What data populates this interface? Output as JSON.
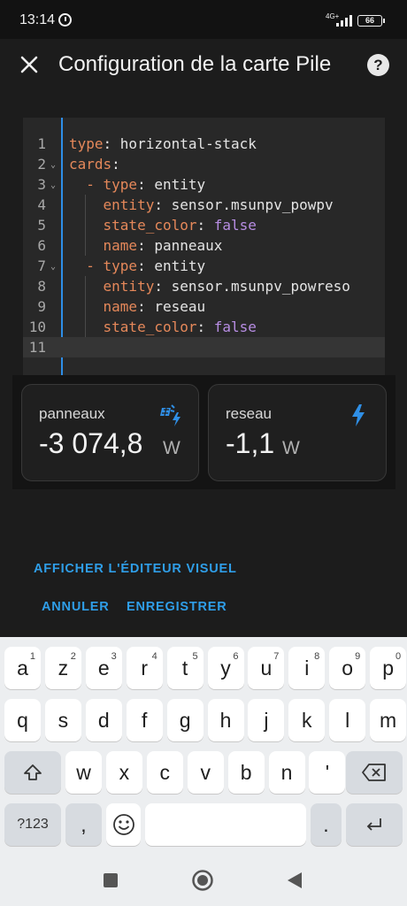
{
  "status_bar": {
    "time": "13:14",
    "network": "4G+",
    "battery": "66"
  },
  "header": {
    "title": "Configuration de la carte Pile",
    "close_icon": "close-icon",
    "help_icon": "help-icon",
    "help_glyph": "?"
  },
  "editor": {
    "lines": [
      {
        "n": "1",
        "indent": "",
        "key": "type",
        "value": "horizontal-stack",
        "value_type": "string",
        "fold": false
      },
      {
        "n": "2",
        "indent": "",
        "key": "cards",
        "value": "",
        "value_type": "string",
        "fold": true
      },
      {
        "n": "3",
        "indent": "  - ",
        "key": "type",
        "value": "entity",
        "value_type": "string",
        "fold": true
      },
      {
        "n": "4",
        "indent": "    ",
        "key": "entity",
        "value": "sensor.msunpv_powpv",
        "value_type": "string",
        "fold": false
      },
      {
        "n": "5",
        "indent": "    ",
        "key": "state_color",
        "value": "false",
        "value_type": "boolean",
        "fold": false
      },
      {
        "n": "6",
        "indent": "    ",
        "key": "name",
        "value": "panneaux",
        "value_type": "string",
        "fold": false
      },
      {
        "n": "7",
        "indent": "  - ",
        "key": "type",
        "value": "entity",
        "value_type": "string",
        "fold": true
      },
      {
        "n": "8",
        "indent": "    ",
        "key": "entity",
        "value": "sensor.msunpv_powreso",
        "value_type": "string",
        "fold": false
      },
      {
        "n": "9",
        "indent": "    ",
        "key": "name",
        "value": "reseau",
        "value_type": "string",
        "fold": false
      },
      {
        "n": "10",
        "indent": "    ",
        "key": "state_color",
        "value": "false",
        "value_type": "boolean",
        "fold": false
      },
      {
        "n": "11",
        "indent": "",
        "key": "",
        "value": "",
        "value_type": "string",
        "fold": false
      }
    ],
    "active_line": "11"
  },
  "preview_cards": [
    {
      "name": "panneaux",
      "value": "-3 074,8",
      "unit": "W",
      "icon": "solar-power-icon"
    },
    {
      "name": "reseau",
      "value": "-1,1",
      "unit": "W",
      "icon": "lightning-bolt-icon"
    }
  ],
  "actions": {
    "visual_editor": "AFFICHER L'ÉDITEUR VISUEL",
    "cancel": "ANNULER",
    "save": "ENREGISTRER"
  },
  "keyboard": {
    "row1": [
      {
        "k": "a",
        "hint": "1"
      },
      {
        "k": "z",
        "hint": "2"
      },
      {
        "k": "e",
        "hint": "3"
      },
      {
        "k": "r",
        "hint": "4"
      },
      {
        "k": "t",
        "hint": "5"
      },
      {
        "k": "y",
        "hint": "6"
      },
      {
        "k": "u",
        "hint": "7"
      },
      {
        "k": "i",
        "hint": "8"
      },
      {
        "k": "o",
        "hint": "9"
      },
      {
        "k": "p",
        "hint": "0"
      }
    ],
    "row2": [
      "q",
      "s",
      "d",
      "f",
      "g",
      "h",
      "j",
      "k",
      "l",
      "m"
    ],
    "row3": [
      "w",
      "x",
      "c",
      "v",
      "b",
      "n",
      "'"
    ],
    "symbols_label": "?123",
    "comma": ",",
    "period": ".",
    "shift_icon": "shift-icon",
    "backspace_icon": "backspace-icon",
    "emoji_icon": "emoji-icon",
    "enter_icon": "enter-icon"
  },
  "nav_bar": {
    "recents_icon": "recents-icon",
    "home_icon": "home-icon",
    "back_icon": "back-icon"
  },
  "colors": {
    "accent": "#2f9ee8",
    "yaml_key": "#e5885a",
    "yaml_boolean": "#b78de3",
    "background": "#1c1c1c"
  }
}
